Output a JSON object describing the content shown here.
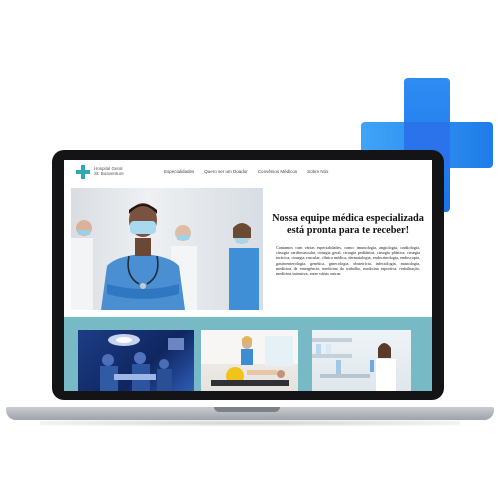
{
  "nav": {
    "logo_line1": "Hospital Geral",
    "logo_line2": "St. Boaventure",
    "links": [
      "Especialidades",
      "Quero ser um Doador",
      "Convênios Médicos",
      "Sobre Nós"
    ]
  },
  "hero": {
    "title": "Nossa equipe médica especializada está pronta para te receber!",
    "body": "Contamos com várias especialidades, como: imunologia, angiologia, cardiologia, cirurgia cardiovascular, cirurgia geral, cirurgia pediátrica, cirurgia plástica, cirurgia torácica, cirurgia vascular, clínica médica, dermatologia, endocrinologia, endoscopia, gastroenterologia, genética, ginecologia, obstetrícia, infectologia, mastologia, medicina de emergência, medicina do trabalho, medicina esportiva, reabilitação, medicina intensiva, entre várias outras."
  },
  "colors": {
    "accent_teal": "#2fa7b4",
    "band": "#77b9c4",
    "cross_blue": "#1f7be9"
  },
  "icons": {
    "logo": "medical-cross-icon",
    "decoration": "large-blue-cross-icon"
  }
}
